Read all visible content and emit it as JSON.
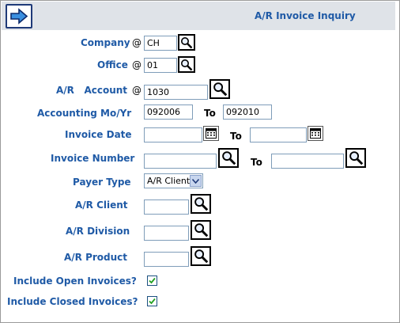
{
  "header": {
    "title": "A/R Invoice Inquiry",
    "go_icon": "arrow-right-icon"
  },
  "form": {
    "company": {
      "label": "Company",
      "prefix": "@",
      "value": "CH"
    },
    "office": {
      "label": "Office",
      "prefix": "@",
      "value": "01"
    },
    "account": {
      "label": "A/R   Account",
      "prefix": "@",
      "value": "1030"
    },
    "accounting_period": {
      "label": "Accounting Mo/Yr",
      "from": "092006",
      "to_label": "To",
      "to": "092010"
    },
    "invoice_date": {
      "label": "Invoice Date",
      "from": "",
      "to_label": "To",
      "to": ""
    },
    "invoice_number": {
      "label": "Invoice Number",
      "from": "",
      "to_label": "To",
      "to": ""
    },
    "payer_type": {
      "label": "Payer Type",
      "selected": "A/R Client"
    },
    "ar_client": {
      "label": "A/R Client",
      "value": ""
    },
    "ar_division": {
      "label": "A/R Division",
      "value": ""
    },
    "ar_product": {
      "label": "A/R Product",
      "value": ""
    },
    "include_open": {
      "label": "Include Open Invoices?",
      "checked": true
    },
    "include_closed": {
      "label": "Include Closed Invoices?",
      "checked": true
    }
  },
  "icons": {
    "lookup": "magnifier-icon",
    "calendar": "calendar-icon",
    "dropdown": "chevron-down-icon",
    "check": "checkmark-icon"
  },
  "colors": {
    "label_blue": "#1f5aa6",
    "header_bg": "#dfe3e8",
    "button_border": "#1f3a78"
  }
}
